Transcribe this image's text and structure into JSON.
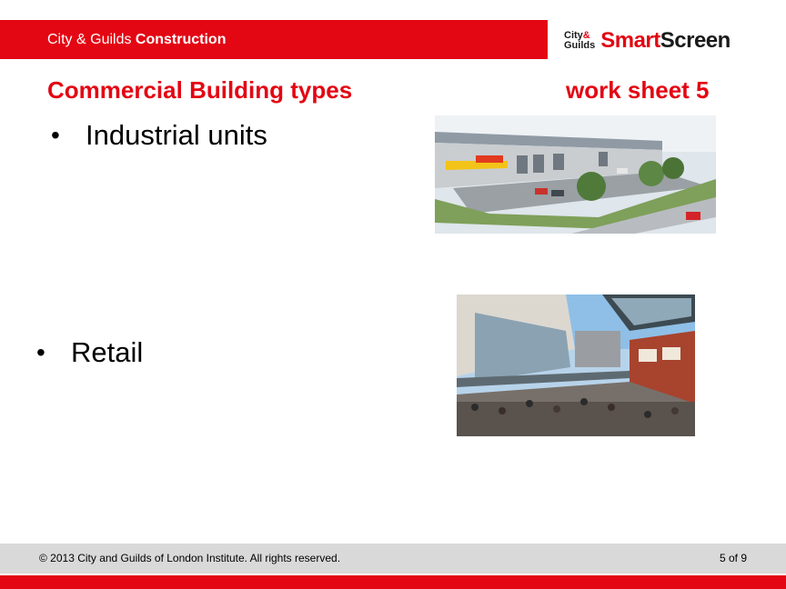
{
  "header": {
    "prefix": "City & Guilds",
    "section": "Construction"
  },
  "brand": {
    "logo_line1": "City",
    "logo_amp": "&",
    "logo_line2": "Guilds",
    "smart": "Smart",
    "screen": "Screen"
  },
  "slide": {
    "title": "Commercial Building types",
    "worksheet": "work sheet 5",
    "bullets": [
      {
        "marker": "•",
        "text": "Industrial units"
      },
      {
        "marker": "•",
        "text": "Retail"
      }
    ]
  },
  "footer": {
    "copyright": "© 2013 City and Guilds of London Institute. All rights reserved.",
    "page": "5 of 9"
  },
  "colors": {
    "accent_red": "#e30613",
    "footer_grey": "#d9d9d9"
  }
}
